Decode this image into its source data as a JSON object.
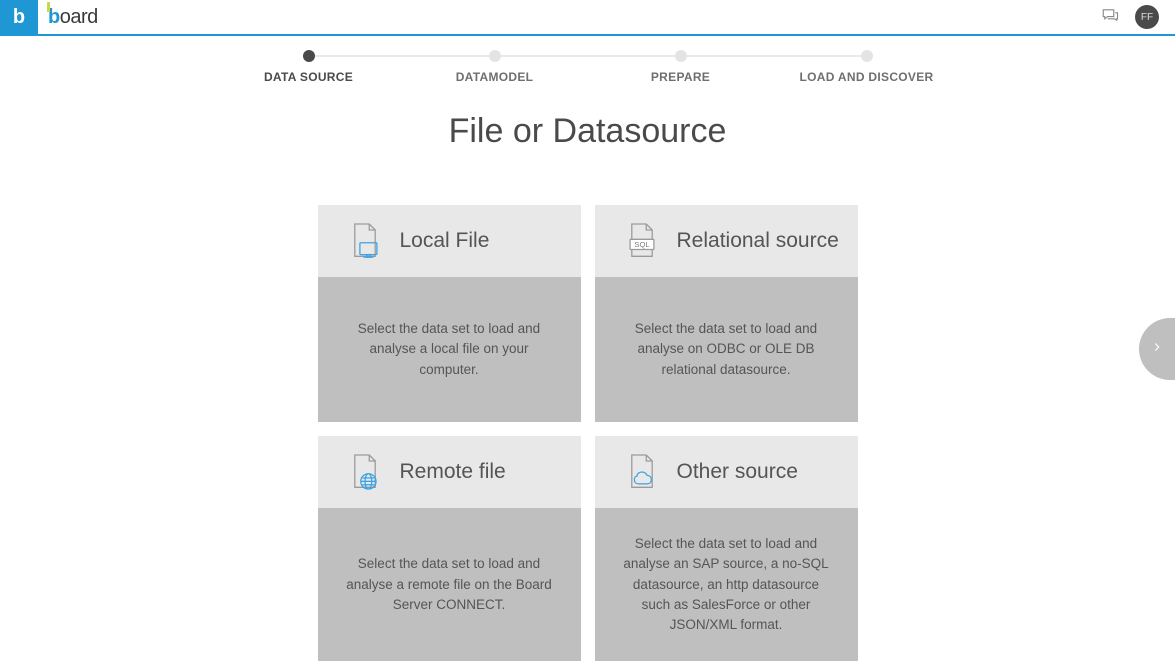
{
  "topbar": {
    "logo_b": "b",
    "logo_rest": "oard",
    "avatar_initials": "FF"
  },
  "stepper": {
    "steps": [
      {
        "label": "DATA SOURCE",
        "active": true
      },
      {
        "label": "DATAMODEL",
        "active": false
      },
      {
        "label": "PREPARE",
        "active": false
      },
      {
        "label": "LOAD AND DISCOVER",
        "active": false
      }
    ]
  },
  "heading": "File or Datasource",
  "cards": [
    {
      "id": "local-file",
      "title": "Local File",
      "desc": "Select the data set to load and analyse a local file on your computer."
    },
    {
      "id": "relational-source",
      "title": "Relational source",
      "desc": "Select the data set to load and analyse on ODBC or OLE DB relational datasource."
    },
    {
      "id": "remote-file",
      "title": "Remote file",
      "desc": "Select the data set to load and analyse a remote file on the Board Server CONNECT."
    },
    {
      "id": "other-source",
      "title": "Other source",
      "desc": "Select the data set to load and analyse an SAP source, a no-SQL datasource, an http datasource such as SalesForce or other JSON/XML format."
    }
  ]
}
